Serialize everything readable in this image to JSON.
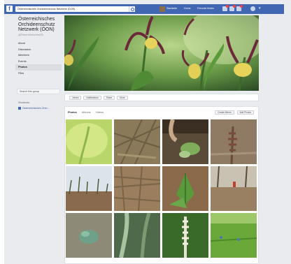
{
  "topbar": {
    "logo": "f",
    "search_text": "Österreichisches Orchideenschutz Netzwerk (ÖON)",
    "links": [
      "Startseite",
      "Home",
      "Freunde finden"
    ],
    "icons": [
      "friends-icon",
      "messages-icon",
      "notifications-icon",
      "help-icon"
    ]
  },
  "page": {
    "name": "Österreichisches Orchideenschutz Netzwerk (ÖON)",
    "handle": "@ÖsterreichischesON",
    "nav": [
      {
        "label": "About",
        "active": false
      },
      {
        "label": "Discussion",
        "active": false
      },
      {
        "label": "Members",
        "active": false
      },
      {
        "label": "Events",
        "active": false
      },
      {
        "label": "Photos",
        "active": true
      },
      {
        "label": "Files",
        "active": false
      }
    ],
    "left_button": "Search this group",
    "shortcuts_heading": "Shortcuts",
    "shortcut_item": "Österreichisches Orch..."
  },
  "actions": [
    "Joined",
    "Notifications",
    "Share",
    "More"
  ],
  "photos": {
    "tabs": [
      {
        "label": "Photos",
        "active": true
      },
      {
        "label": "Albums",
        "active": false
      },
      {
        "label": "Videos",
        "active": false
      }
    ],
    "buttons": [
      "Create Album",
      "Add Photos"
    ]
  },
  "colors": {
    "brand": "#4267b2",
    "background": "#e9ebee"
  }
}
